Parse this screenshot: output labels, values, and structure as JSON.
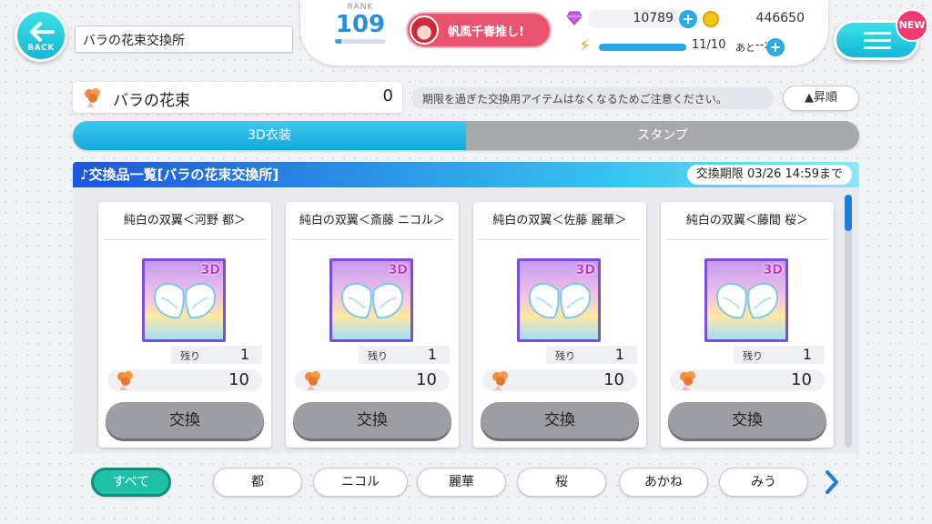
{
  "back": {
    "label": "BACK"
  },
  "page_title": "バラの花束交換所",
  "status": {
    "rank_label": "RANK",
    "rank": "109",
    "oshi_text": "帆風千春推し!",
    "gems": "10789",
    "coins": "446650",
    "stamina": "11/10",
    "stamina_ato": "あと",
    "stamina_time": "--:--"
  },
  "menu": {
    "new_badge": "NEW"
  },
  "owned_item": {
    "label": "バラの花束",
    "count": "0"
  },
  "notice": "期限を過ぎた交換用アイテムはなくなるためご注意ください。",
  "sort_label": "▲昇順",
  "tabs": [
    {
      "label": "3D衣装",
      "active": true
    },
    {
      "label": "スタンプ",
      "active": false
    }
  ],
  "list": {
    "title": "♪交換品一覧[バラの花束交換所]",
    "deadline_label": "交換期限",
    "deadline_value": "03/26 14:59まで"
  },
  "cards": [
    {
      "name": "純白の双翼＜河野 都＞",
      "badge": "3D",
      "remain_label": "残り",
      "remain": "1",
      "cost": "10",
      "button": "交換"
    },
    {
      "name": "純白の双翼＜斎藤 ニコル＞",
      "badge": "3D",
      "remain_label": "残り",
      "remain": "1",
      "cost": "10",
      "button": "交換"
    },
    {
      "name": "純白の双翼＜佐藤 麗華＞",
      "badge": "3D",
      "remain_label": "残り",
      "remain": "1",
      "cost": "10",
      "button": "交換"
    },
    {
      "name": "純白の双翼＜藤間 桜＞",
      "badge": "3D",
      "remain_label": "残り",
      "remain": "1",
      "cost": "10",
      "button": "交換"
    }
  ],
  "filters": [
    "すべて",
    "都",
    "ニコル",
    "麗華",
    "桜",
    "あかね",
    "みう"
  ],
  "colors": {
    "accent": "#17a8dc",
    "active_filter": "#1ec0a6",
    "new_badge": "#f03a6e"
  }
}
